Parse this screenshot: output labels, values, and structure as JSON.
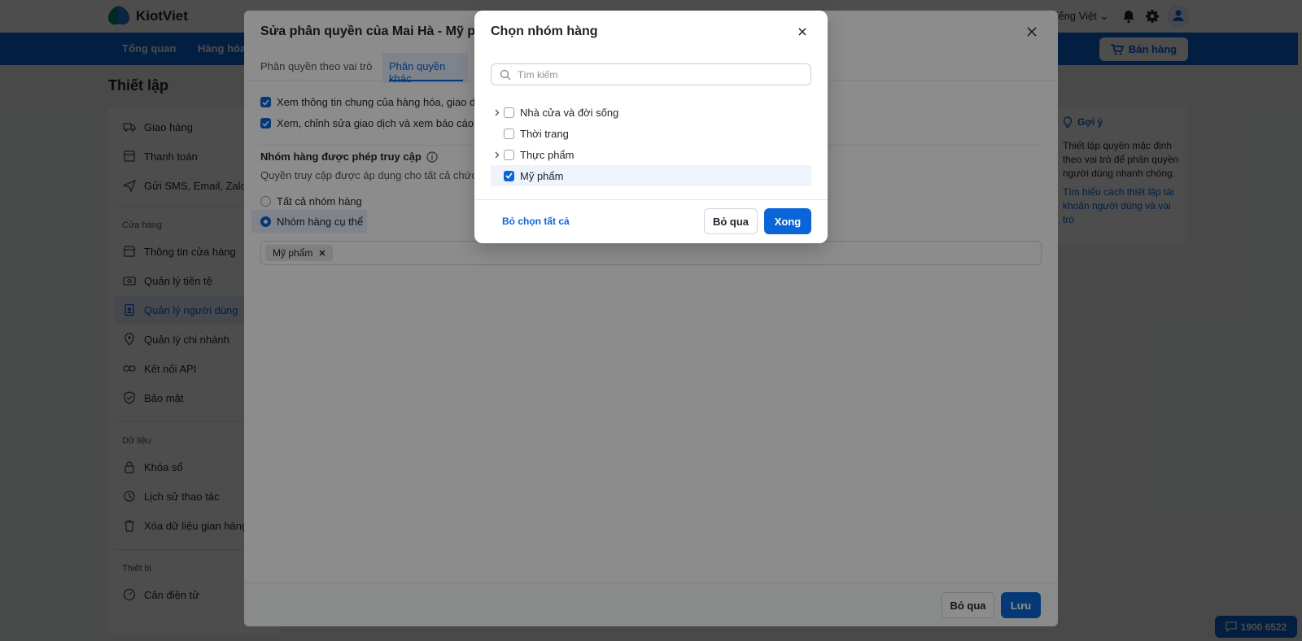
{
  "app": {
    "logo_text": "KiotViet",
    "language": "Tiếng Việt"
  },
  "nav": {
    "items": [
      "Tổng quan",
      "Hàng hóa"
    ],
    "sell_label": "Bán hàng"
  },
  "page": {
    "title": "Thiết lập"
  },
  "sidebar": {
    "top_items": [
      "Giao hàng",
      "Thanh toán",
      "Gửi SMS, Email, Zalo"
    ],
    "store_section": "Cửa hàng",
    "store_items": [
      "Thông tin cửa hàng",
      "Quản lý tiền tệ",
      "Quản lý người dùng",
      "Quản lý chi nhánh",
      "Kết nối API",
      "Bảo mật"
    ],
    "data_section": "Dữ liệu",
    "data_items": [
      "Khóa sổ",
      "Lịch sử thao tác",
      "Xóa dữ liệu gian hàng"
    ],
    "device_section": "Thiết bị",
    "device_items": [
      "Cân điện tử"
    ]
  },
  "hint": {
    "title": "Gợi ý",
    "body": "Thiết lập quyền mặc định theo vai trò để phân quyền người dùng nhanh chóng.",
    "link": "Tìm hiểu cách thiết lập tài khoản người dùng và vai trò"
  },
  "hotline": "1900 6522",
  "permission_modal": {
    "title": "Sửa phân quyền của Mai Hà - Mỹ phẩm",
    "tabs": [
      "Phân quyền theo vai trò",
      "Phân quyền khác"
    ],
    "checks": [
      "Xem thông tin chung của hàng hóa, giao dịch",
      "Xem, chỉnh sửa giao dịch và xem báo cáo của"
    ],
    "group_heading": "Nhóm hàng được phép truy cập",
    "group_desc": "Quyền truy cập được áp dụng cho tất cả chức năng",
    "radio_all": "Tất cả nhóm hàng",
    "radio_specific": "Nhóm hàng cụ thể",
    "selected_tag": "Mỹ phẩm",
    "cancel_label": "Bỏ qua",
    "save_label": "Lưu"
  },
  "group_modal": {
    "title": "Chọn nhóm hàng",
    "search_placeholder": "Tìm kiếm",
    "items": [
      {
        "label": "Nhà cửa và đời sống",
        "checked": false,
        "expandable": true
      },
      {
        "label": "Thời trang",
        "checked": false,
        "expandable": false
      },
      {
        "label": "Thực phẩm",
        "checked": false,
        "expandable": true
      },
      {
        "label": "Mỹ phẩm",
        "checked": true,
        "expandable": false
      }
    ],
    "deselect_all_label": "Bỏ chọn tất cả",
    "cancel_label": "Bỏ qua",
    "done_label": "Xong"
  },
  "colors": {
    "primary": "#0a66d8",
    "logo_green": "#0a8f6e",
    "logo_blue": "#2a7de1"
  }
}
